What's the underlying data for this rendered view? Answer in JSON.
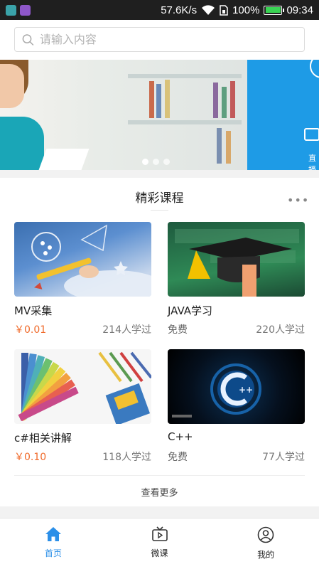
{
  "status_bar": {
    "speed": "57.6K/s",
    "battery": "100%",
    "time": "09:34",
    "battery_color": "#39d353"
  },
  "search": {
    "placeholder": "请输入内容"
  },
  "banner": {
    "label": "直播",
    "dot_count": 3,
    "active_dot": 0
  },
  "section": {
    "title": "精彩课程",
    "more_icon": "more-dots-icon",
    "see_more": "查看更多"
  },
  "courses": [
    {
      "name": "MV采集",
      "price": "￥0.01",
      "learners": "214人学过"
    },
    {
      "name": "JAVA学习",
      "price": "免费",
      "learners": "220人学过"
    },
    {
      "name": "c#相关讲解",
      "price": "￥0.10",
      "learners": "118人学过"
    },
    {
      "name": "C++",
      "price": "免费",
      "learners": "77人学过"
    }
  ],
  "nav": [
    {
      "label": "首页",
      "icon": "home-icon",
      "active": true
    },
    {
      "label": "微课",
      "icon": "tv-icon",
      "active": false
    },
    {
      "label": "我的",
      "icon": "user-icon",
      "active": false
    }
  ],
  "colors": {
    "accent": "#2b8fe8",
    "price": "#f06a2a"
  }
}
